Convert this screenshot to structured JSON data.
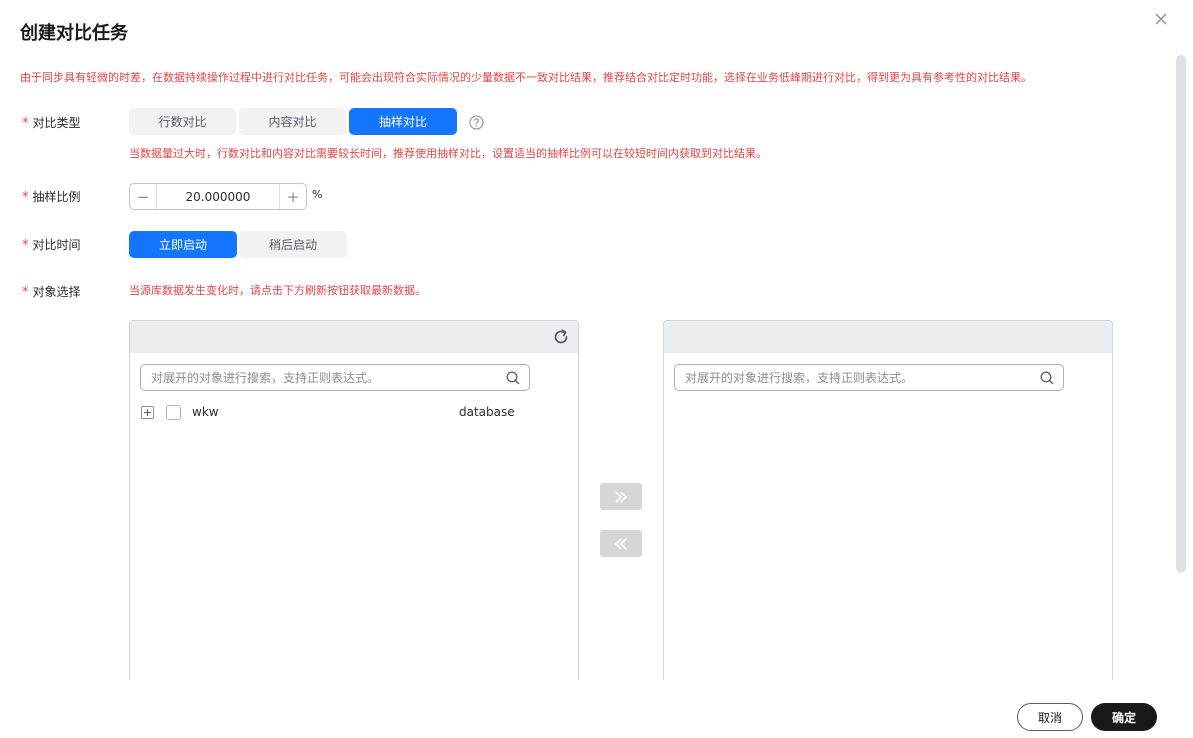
{
  "dialog": {
    "title": "创建对比任务",
    "warning": "由于同步具有轻微的时差，在数据持续操作过程中进行对比任务，可能会出现符合实际情况的少量数据不一致对比结果，推荐结合对比定时功能，选择在业务低峰期进行对比，得到更为具有参考性的对比结果。"
  },
  "compare_type": {
    "label": "对比类型",
    "options": [
      "行数对比",
      "内容对比",
      "抽样对比"
    ],
    "selected": "抽样对比",
    "hint": "当数据量过大时，行数对比和内容对比需要较长时间，推荐使用抽样对比，设置适当的抽样比例可以在较短时间内获取到对比结果。"
  },
  "sample_ratio": {
    "label": "抽样比例",
    "value": "20.000000",
    "unit": "%",
    "minus": "−",
    "plus": "+"
  },
  "compare_time": {
    "label": "对比时间",
    "options": [
      "立即启动",
      "稍后启动"
    ],
    "selected": "立即启动"
  },
  "object_select": {
    "label": "对象选择",
    "hint": "当源库数据发生变化时，请点击下方刷新按钮获取最新数据。",
    "left_panel": {
      "search_placeholder": "对展开的对象进行搜索，支持正则表达式。",
      "items": [
        {
          "name": "wkw",
          "type": "database"
        }
      ]
    },
    "right_panel": {
      "search_placeholder": "对展开的对象进行搜索，支持正则表达式。"
    }
  },
  "footer": {
    "cancel_label": "取消",
    "ok_label": "确定"
  },
  "colors": {
    "primary": "#1476ff",
    "danger": "#e54545",
    "dark": "#191919"
  }
}
